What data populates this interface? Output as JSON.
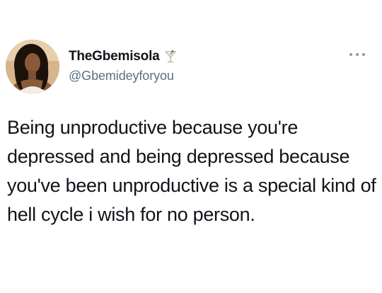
{
  "author": {
    "display_name": "TheGbemisola",
    "name_emoji_icon": "cocktail-glass-icon",
    "handle": "@Gbemideyforyou",
    "avatar_icon": "profile-photo"
  },
  "menu": {
    "icon": "more-options-icon"
  },
  "tweet": {
    "text": "Being unproductive because you're depressed and being depressed because you've been unproductive is a special kind of hell cycle i wish for no person."
  },
  "colors": {
    "text": "#0f1419",
    "secondary_text": "#5b7083",
    "icon_gray": "#8899a6",
    "background": "#ffffff"
  }
}
